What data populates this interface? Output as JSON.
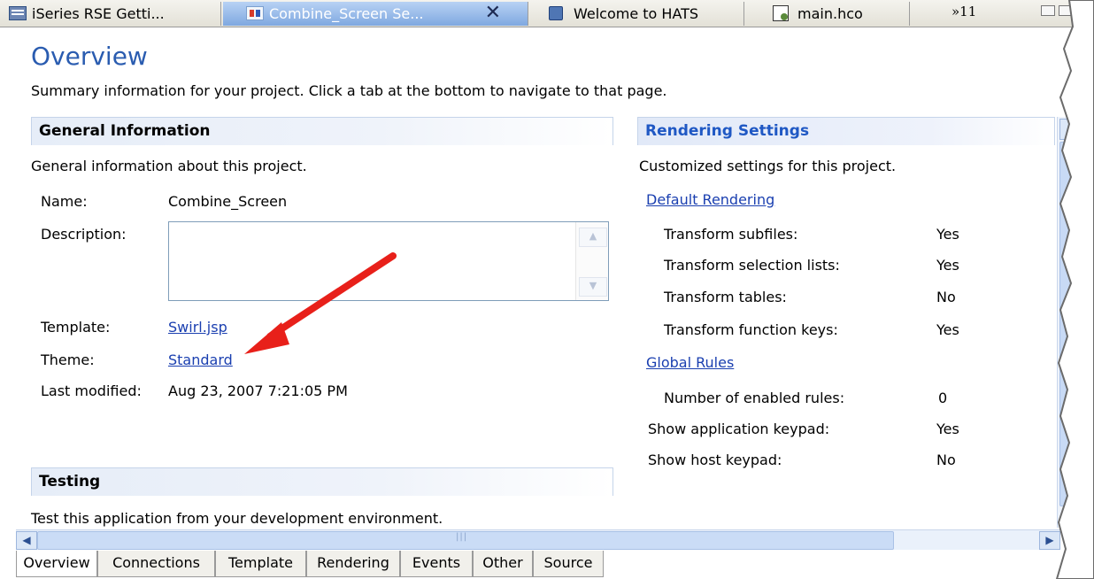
{
  "tabs": [
    {
      "label": "iSeries RSE Getti...",
      "icon": "rse-perspective-icon"
    },
    {
      "label": "Combine_Screen Se...",
      "icon": "project-settings-icon",
      "active": true
    },
    {
      "label": "Welcome to HATS",
      "icon": "hats-icon"
    },
    {
      "label": "main.hco",
      "icon": "hco-file-icon"
    }
  ],
  "tabs_overflow": "»11",
  "overview": {
    "title": "Overview",
    "subtitle": "Summary information for your project. Click a tab at the bottom to navigate to that page."
  },
  "general": {
    "header": "General Information",
    "description": "General information about this project.",
    "name_label": "Name:",
    "name_value": "Combine_Screen",
    "description_label": "Description:",
    "description_value": "",
    "template_label": "Template:",
    "template_value": "Swirl.jsp",
    "theme_label": "Theme:",
    "theme_value": "Standard",
    "modified_label": "Last modified:",
    "modified_value": "Aug 23, 2007 7:21:05 PM"
  },
  "testing": {
    "header": "Testing",
    "description": "Test this application from your development environment."
  },
  "rendering": {
    "header": "Rendering Settings",
    "description": "Customized settings for this project.",
    "default_link": "Default Rendering",
    "items": [
      {
        "label": "Transform subfiles:",
        "value": "Yes"
      },
      {
        "label": "Transform selection lists:",
        "value": "Yes"
      },
      {
        "label": "Transform tables:",
        "value": "No"
      },
      {
        "label": "Transform function keys:",
        "value": "Yes"
      }
    ],
    "global_link": "Global Rules",
    "rules_label": "Number of enabled rules:",
    "rules_value": "0",
    "app_keypad_label": "Show application keypad:",
    "app_keypad_value": "Yes",
    "host_keypad_label": "Show host keypad:",
    "host_keypad_value": "No"
  },
  "bottom_tabs": [
    "Overview",
    "Connections",
    "Template",
    "Rendering",
    "Events",
    "Other",
    "Source"
  ],
  "colors": {
    "accent": "#2a5cb0",
    "link": "#1a3fb0",
    "arrow": "#e8201a"
  }
}
